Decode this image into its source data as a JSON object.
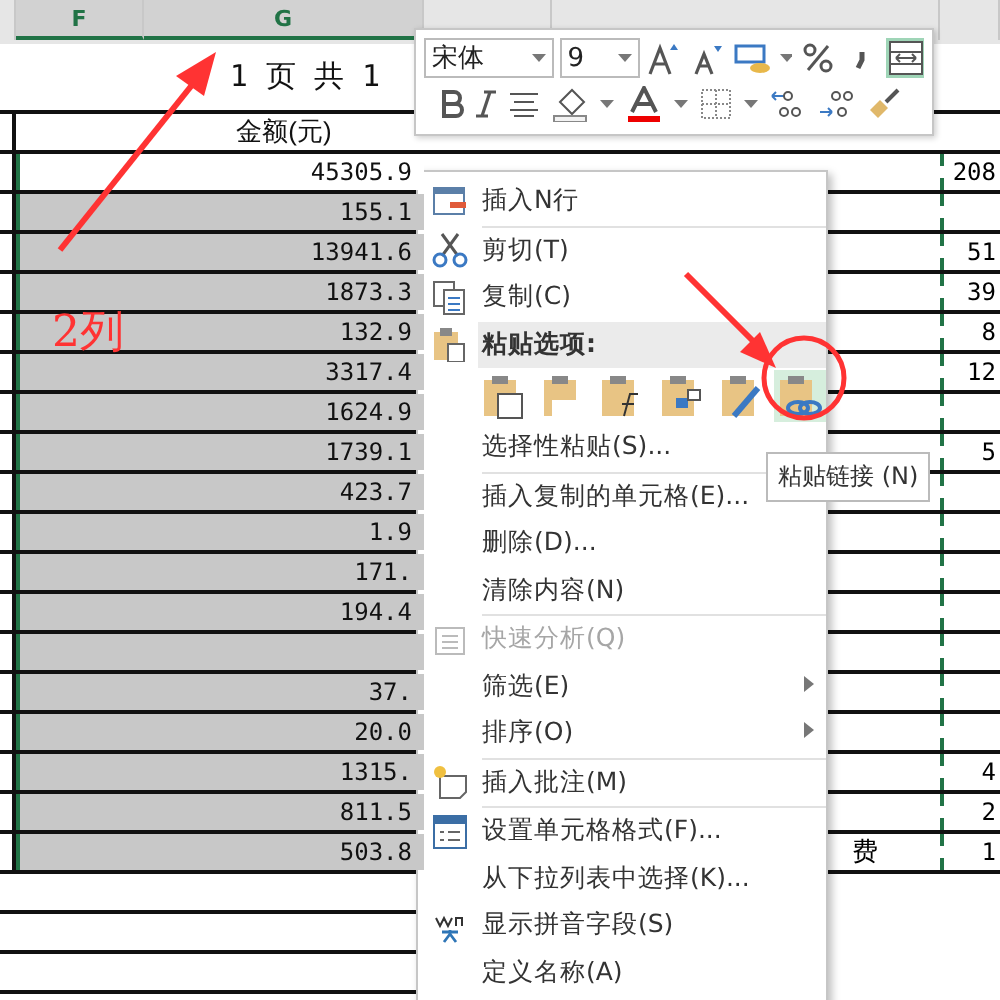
{
  "column_headers": [
    {
      "letter": "F",
      "selected": true
    },
    {
      "letter": "G",
      "selected": true
    }
  ],
  "page_info": "1 页 共 1",
  "amount_header": "金额(元)",
  "rows": [
    {
      "amount": "45305.9",
      "active": true,
      "col_k": "208"
    },
    {
      "amount": "155.1",
      "active": false,
      "col_k": ""
    },
    {
      "amount": "13941.6",
      "active": false,
      "col_k": "51"
    },
    {
      "amount": "1873.3",
      "active": false,
      "col_k": "39"
    },
    {
      "amount": "132.9",
      "active": false,
      "col_k": "8"
    },
    {
      "amount": "3317.4",
      "active": false,
      "col_k": "12"
    },
    {
      "amount": "1624.9",
      "active": false,
      "col_k": ""
    },
    {
      "amount": "1739.1",
      "active": false,
      "col_k": "5"
    },
    {
      "amount": "423.7",
      "active": false,
      "col_k": ""
    },
    {
      "amount": "1.9",
      "active": false,
      "col_k": ""
    },
    {
      "amount": "171.",
      "active": false,
      "col_k": ""
    },
    {
      "amount": "194.4",
      "active": false,
      "col_k": ""
    },
    {
      "amount": "",
      "active": false,
      "col_k": ""
    },
    {
      "amount": "37.",
      "active": false,
      "col_k": ""
    },
    {
      "amount": "20.0",
      "active": false,
      "col_k": ""
    },
    {
      "amount": "1315.",
      "active": false,
      "col_k": "4"
    },
    {
      "amount": "811.5",
      "active": false,
      "col_k": "2"
    },
    {
      "amount": "503.8",
      "active": false,
      "item": "费",
      "col_k": "1"
    }
  ],
  "annotation": "2列",
  "mini_toolbar": {
    "font": "宋体",
    "size": "9",
    "wrap_selected": true
  },
  "menu": {
    "groups": [
      [
        {
          "label": "插入N行",
          "kind": "insert-row",
          "disabled": false,
          "submenu": false
        }
      ],
      [
        {
          "label": "剪切(T)",
          "kind": "cut",
          "disabled": false,
          "submenu": false
        },
        {
          "label": "复制(C)",
          "kind": "copy",
          "disabled": false,
          "submenu": false
        },
        {
          "label": "粘贴选项:",
          "kind": "paste-header",
          "disabled": false,
          "submenu": false
        },
        {
          "kind": "paste-options",
          "options": [
            {
              "selected": false
            },
            {
              "selected": false
            },
            {
              "selected": false
            },
            {
              "selected": false
            },
            {
              "selected": false
            },
            {
              "selected": true
            }
          ]
        },
        {
          "label": "选择性粘贴(S)...",
          "kind": "plain",
          "disabled": false,
          "submenu": false
        }
      ],
      [
        {
          "label": "插入复制的单元格(E)...",
          "kind": "plain",
          "disabled": false,
          "submenu": false
        },
        {
          "label": "删除(D)...",
          "kind": "plain",
          "disabled": false,
          "submenu": false
        },
        {
          "label": "清除内容(N)",
          "kind": "plain",
          "disabled": false,
          "submenu": false
        }
      ],
      [
        {
          "label": "快速分析(Q)",
          "kind": "quick-analysis",
          "disabled": true,
          "submenu": false
        },
        {
          "label": "筛选(E)",
          "kind": "plain",
          "disabled": false,
          "submenu": true
        },
        {
          "label": "排序(O)",
          "kind": "plain",
          "disabled": false,
          "submenu": true
        }
      ],
      [
        {
          "label": "插入批注(M)",
          "kind": "comment",
          "disabled": false,
          "submenu": false
        }
      ],
      [
        {
          "label": "设置单元格格式(F)...",
          "kind": "format-cells",
          "disabled": false,
          "submenu": false
        },
        {
          "label": "从下拉列表中选择(K)...",
          "kind": "plain",
          "disabled": false,
          "submenu": false
        },
        {
          "label": "显示拼音字段(S)",
          "kind": "pinyin",
          "disabled": false,
          "submenu": false
        },
        {
          "label": "定义名称(A)",
          "kind": "plain",
          "disabled": false,
          "submenu": false
        }
      ]
    ]
  },
  "tooltip": "粘贴链接 (N)"
}
